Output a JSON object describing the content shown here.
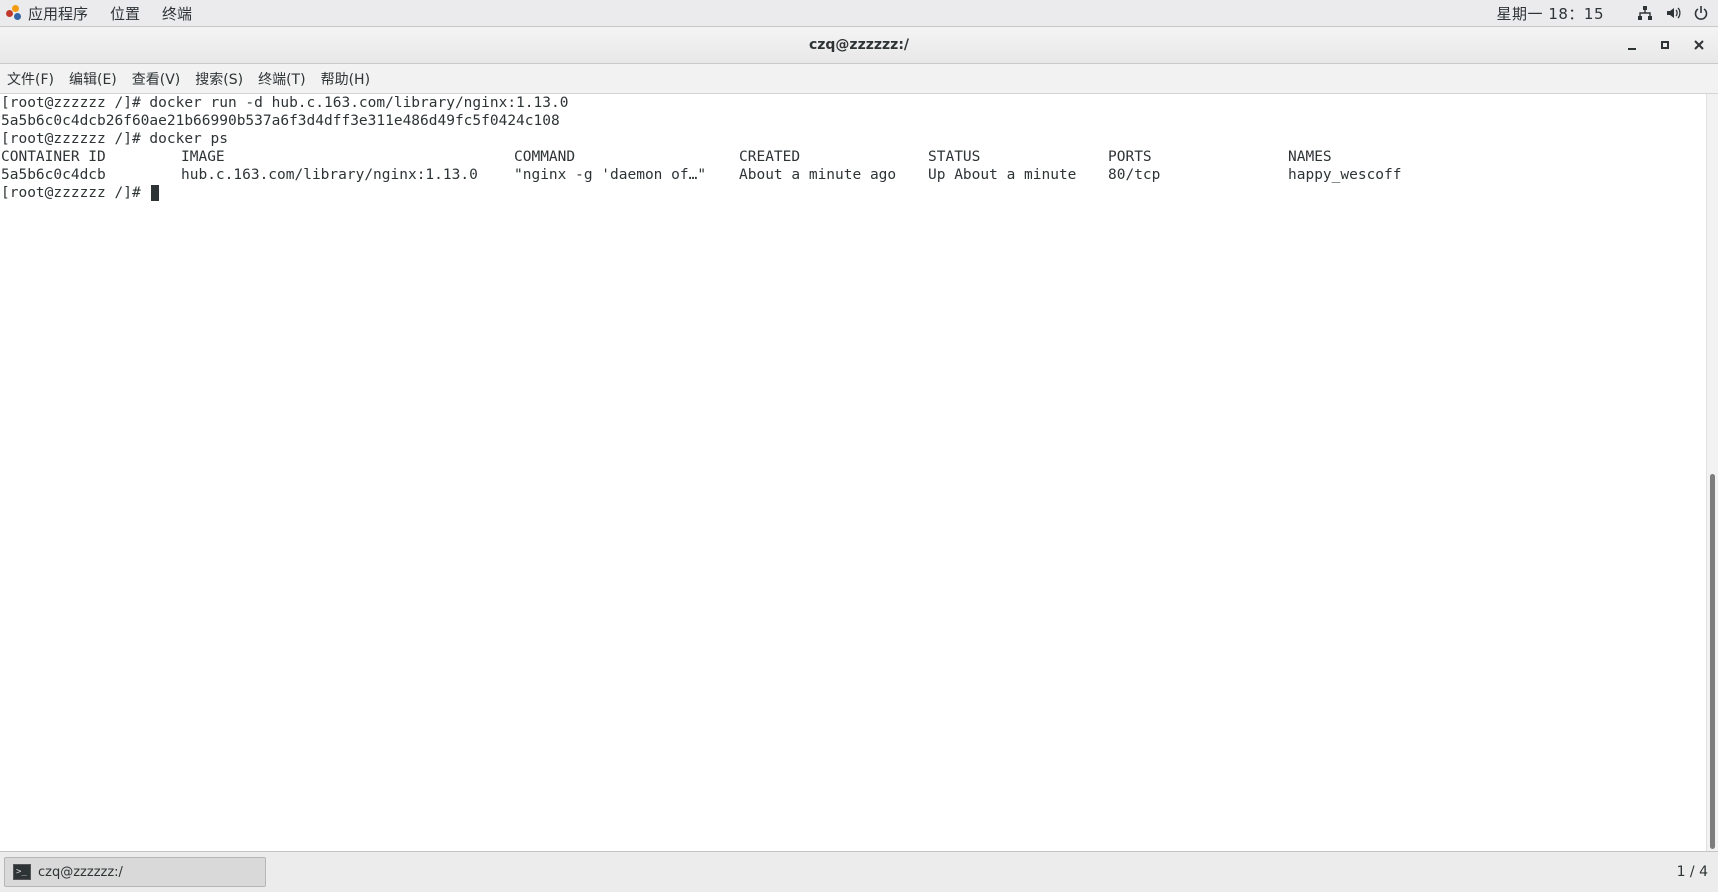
{
  "top_panel": {
    "menu": [
      "应用程序",
      "位置",
      "终端"
    ],
    "clock": "星期一 18：15",
    "tray_icons": [
      "network-icon",
      "volume-icon",
      "power-icon"
    ]
  },
  "window": {
    "title": "czq@zzzzzz:/",
    "buttons": [
      "minimize",
      "maximize",
      "close"
    ]
  },
  "menubar": [
    "文件(F)",
    "编辑(E)",
    "查看(V)",
    "搜索(S)",
    "终端(T)",
    "帮助(H)"
  ],
  "terminal": {
    "lines": [
      "[root@zzzzzz /]# docker run -d hub.c.163.com/library/nginx:1.13.0",
      "5a5b6c0c4dcb26f60ae21b66990b537a6f3d4dff3e311e486d49fc5f0424c108",
      "[root@zzzzzz /]# docker ps"
    ],
    "table": {
      "headers": [
        "CONTAINER ID",
        "IMAGE",
        "COMMAND",
        "CREATED",
        "STATUS",
        "PORTS",
        "NAMES"
      ],
      "rows": [
        [
          "5a5b6c0c4dcb",
          "hub.c.163.com/library/nginx:1.13.0",
          "\"nginx -g 'daemon of…\"",
          "About a minute ago",
          "Up About a minute",
          "80/tcp",
          "happy_wescoff"
        ]
      ]
    },
    "prompt": "[root@zzzzzz /]# "
  },
  "taskbar": {
    "item_label": "czq@zzzzzz:/",
    "workspace": "1 / 4"
  }
}
